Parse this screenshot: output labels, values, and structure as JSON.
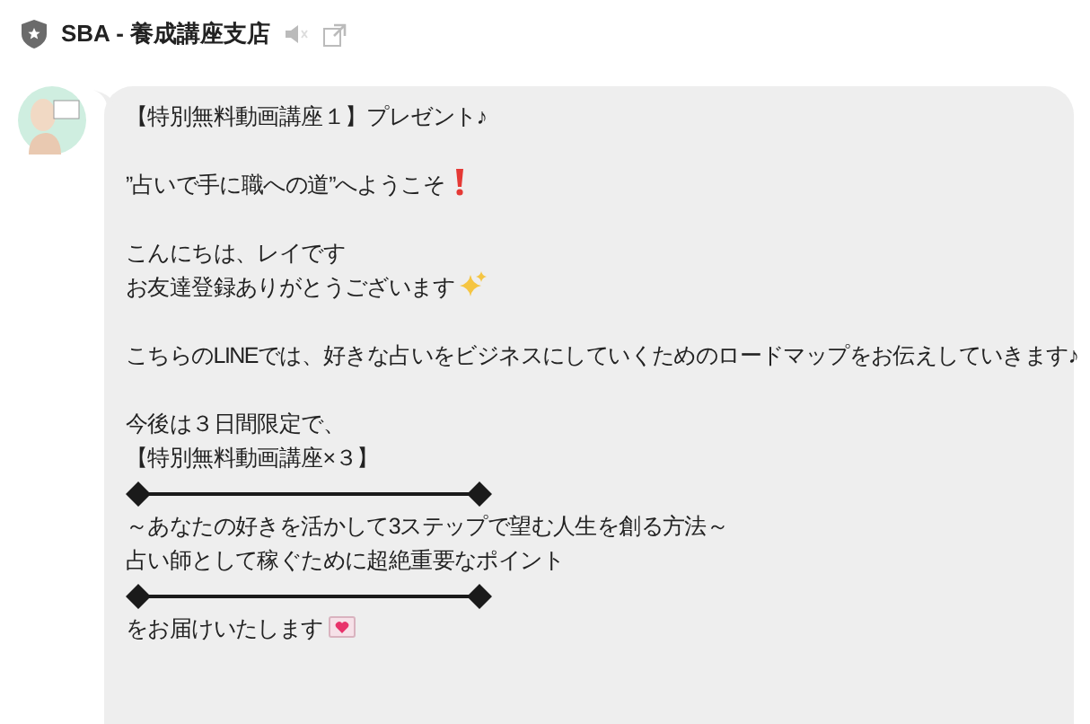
{
  "header": {
    "title": "SBA - 養成講座支店",
    "muted": true
  },
  "message": {
    "paragraphs": [
      [
        {
          "kind": "text",
          "text": "【特別無料動画講座１】プレゼント♪"
        }
      ],
      [
        {
          "kind": "text_exclaim",
          "text": "”占いで手に職への道”へようこそ"
        }
      ],
      [
        {
          "kind": "text",
          "text": "こんにちは、レイです"
        },
        {
          "kind": "text_sparkle",
          "text": "お友達登録ありがとうございます"
        }
      ],
      [
        {
          "kind": "text",
          "text": "こちらのLINEでは、好きな占いをビジネスにしていくためのロードマップをお伝えしていきます♪"
        }
      ],
      [
        {
          "kind": "text",
          "text": "今後は３日間限定で、"
        },
        {
          "kind": "text",
          "text": "【特別無料動画講座×３】"
        },
        {
          "kind": "divider"
        },
        {
          "kind": "text",
          "text": "～あなたの好きを活かして3ステップで望む人生を創る方法～"
        },
        {
          "kind": "text",
          "text": "占い師として稼ぐために超絶重要なポイント"
        },
        {
          "kind": "divider"
        },
        {
          "kind": "text_letter",
          "text": "をお届けいたします"
        }
      ]
    ]
  }
}
